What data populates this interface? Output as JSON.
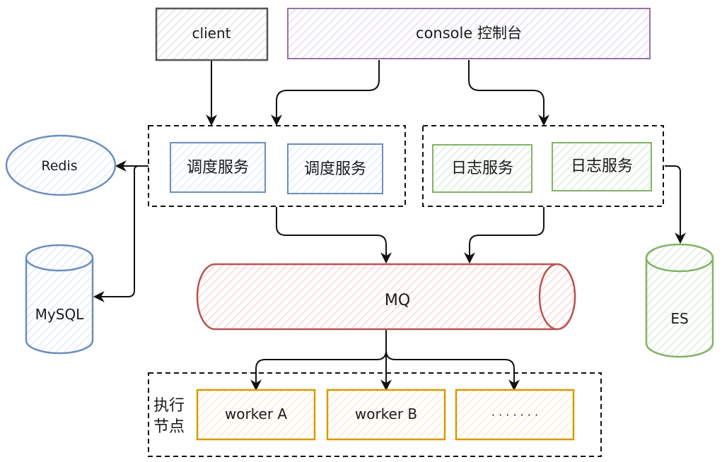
{
  "nodes": {
    "client": "client",
    "console": "console 控制台",
    "scheduler_1": "调度服务",
    "scheduler_2": "调度服务",
    "log_1": "日志服务",
    "log_2": "日志服务",
    "redis": "Redis",
    "mysql": "MySQL",
    "mq": "MQ",
    "es": "ES",
    "exec_group_line1": "执行",
    "exec_group_line2": "节点",
    "worker_a": "worker A",
    "worker_b": "worker B",
    "worker_more": "· · · · · · ·"
  },
  "colors": {
    "gray": "#555555",
    "purple": "#9673a6",
    "purple_fill": "#e1d5e7",
    "blue": "#6c8ebf",
    "blue_fill": "#dae8fc",
    "green": "#82b366",
    "green_fill": "#d5e8d4",
    "red": "#b85450",
    "red_fill": "#f8cecc",
    "orange": "#d79b00",
    "orange_fill": "#ffe6cc",
    "arrow": "#111111"
  },
  "edges": [
    {
      "from": "client",
      "to": "scheduler_group"
    },
    {
      "from": "console",
      "to": "scheduler_group"
    },
    {
      "from": "console",
      "to": "log_group"
    },
    {
      "from": "scheduler_group",
      "to": "redis"
    },
    {
      "from": "scheduler_group",
      "to": "mysql"
    },
    {
      "from": "scheduler_group",
      "to": "mq"
    },
    {
      "from": "log_group",
      "to": "mq"
    },
    {
      "from": "log_group",
      "to": "es"
    },
    {
      "from": "mq",
      "to": "worker_a"
    },
    {
      "from": "mq",
      "to": "worker_b"
    },
    {
      "from": "mq",
      "to": "worker_more"
    }
  ]
}
